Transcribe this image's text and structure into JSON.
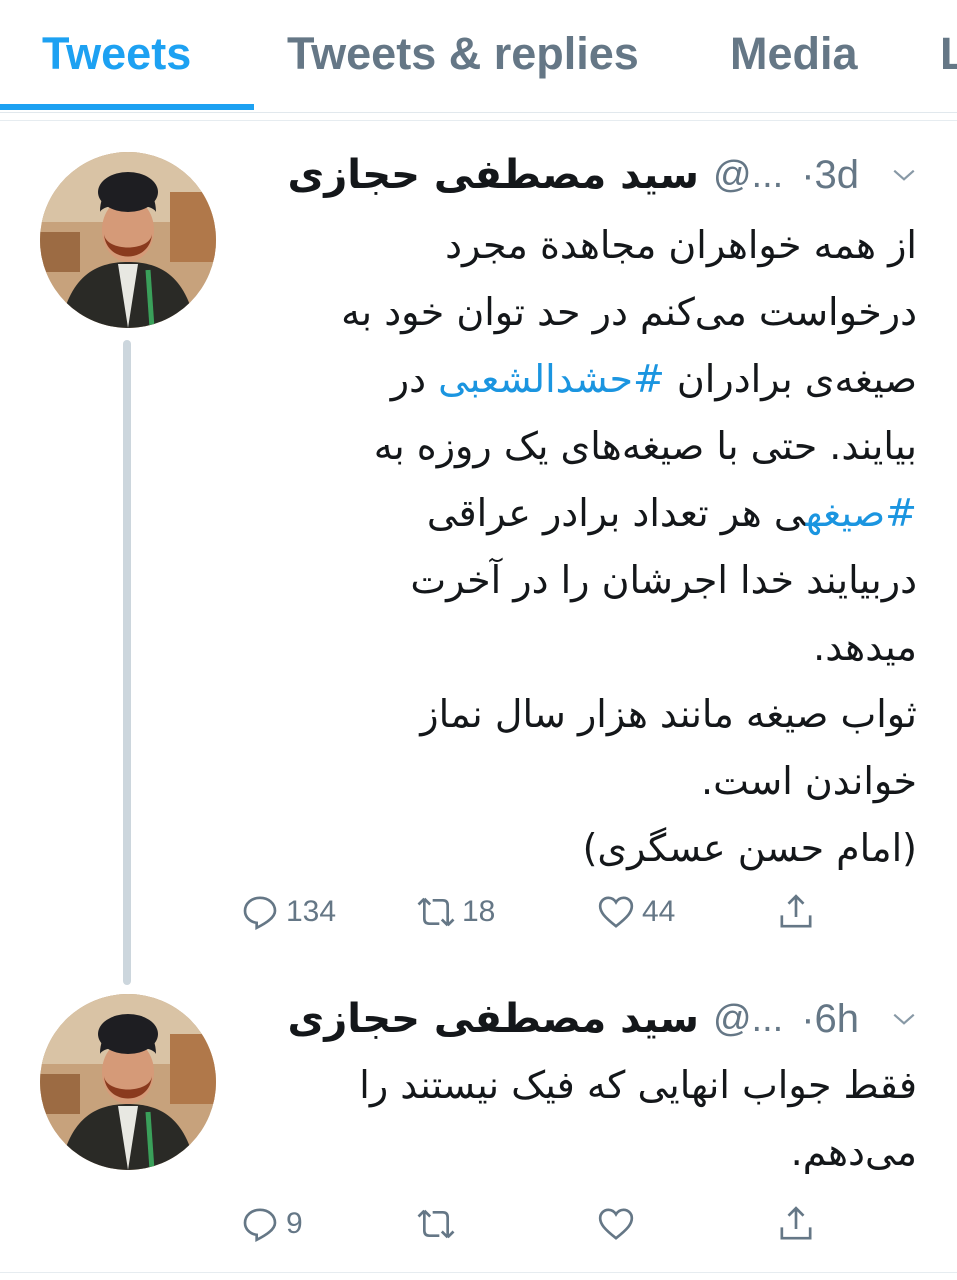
{
  "tabs": [
    "Tweets",
    "Tweets & replies",
    "Media",
    "L"
  ],
  "tweets": [
    {
      "name": "سید مصطفی حجازی",
      "handle": "@...",
      "time": "·3d",
      "lines_before": "از همه خواهران مجاهدة مجرد\nدرخواست می‌کنم در حد توان خود به\nصیغه‌ی برادران ",
      "hashtag1": "#حشدالشعبی",
      "lines_mid": " در\nبیایند. حتی با صیغه‌های یک روزه به\n",
      "hashtag2": "#صیغه",
      "lines_after": "ی هر تعداد برادر عراقی\nدربیایند خدا اجرشان را در آخرت\nمیدهد.\nثواب صیغه مانند هزار سال نماز\nخواندن است.\n(امام حسن عسگری)",
      "replies": "134",
      "retweets": "18",
      "likes": "44"
    },
    {
      "name": "سید مصطفی حجازی",
      "handle": "@...",
      "time": "·6h",
      "text": "فقط جواب انهایی که فیک نیستند را\nمی‌دهم.",
      "replies": "9",
      "retweets": "",
      "likes": ""
    }
  ],
  "colors": {
    "accent": "#1da1f2",
    "muted": "#657786",
    "hashtag": "#1b95e0"
  }
}
